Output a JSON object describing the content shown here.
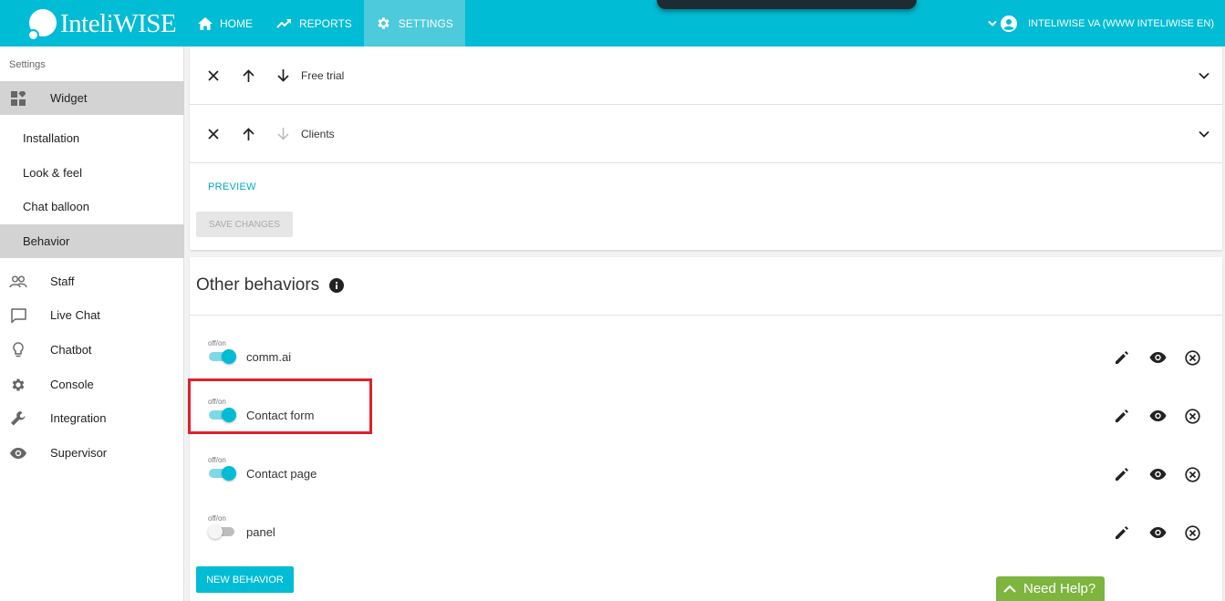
{
  "app": {
    "logo_text": "InteliWISE"
  },
  "nav": [
    {
      "label": "HOME",
      "icon": "home-icon"
    },
    {
      "label": "REPORTS",
      "icon": "trending-icon"
    },
    {
      "label": "SETTINGS",
      "icon": "gear-icon",
      "active": true
    }
  ],
  "account": {
    "label": "INTELIWISE VA (WWW INTELIWISE EN)"
  },
  "sidebar": {
    "title": "Settings",
    "widget": {
      "label": "Widget",
      "icon": "widgets-icon"
    },
    "widget_items": [
      {
        "label": "Installation"
      },
      {
        "label": "Look & feel"
      },
      {
        "label": "Chat balloon"
      },
      {
        "label": "Behavior",
        "active": true
      }
    ],
    "items": [
      {
        "label": "Staff",
        "icon": "people-icon"
      },
      {
        "label": "Live Chat",
        "icon": "chat-bubble-icon"
      },
      {
        "label": "Chatbot",
        "icon": "lightbulb-icon"
      },
      {
        "label": "Console",
        "icon": "gear-icon"
      },
      {
        "label": "Integration",
        "icon": "wrench-icon"
      },
      {
        "label": "Supervisor",
        "icon": "eye-icon"
      }
    ]
  },
  "behavior_list": [
    {
      "name": "Free trial"
    },
    {
      "name": "Clients"
    }
  ],
  "actions": {
    "preview": "PREVIEW",
    "save": "SAVE CHANGES",
    "new_behavior": "NEW BEHAVIOR"
  },
  "other_behaviors": {
    "title": "Other behaviors",
    "toggle_caption": "off/on",
    "items": [
      {
        "label": "comm.ai",
        "enabled": true
      },
      {
        "label": "Contact form",
        "enabled": true
      },
      {
        "label": "Contact page",
        "enabled": true
      },
      {
        "label": "panel",
        "enabled": false
      }
    ]
  },
  "help": {
    "label": "Need Help?"
  },
  "colors": {
    "accent": "#00bcd4",
    "help_green": "#7db53e",
    "highlight": "#e0202b"
  }
}
